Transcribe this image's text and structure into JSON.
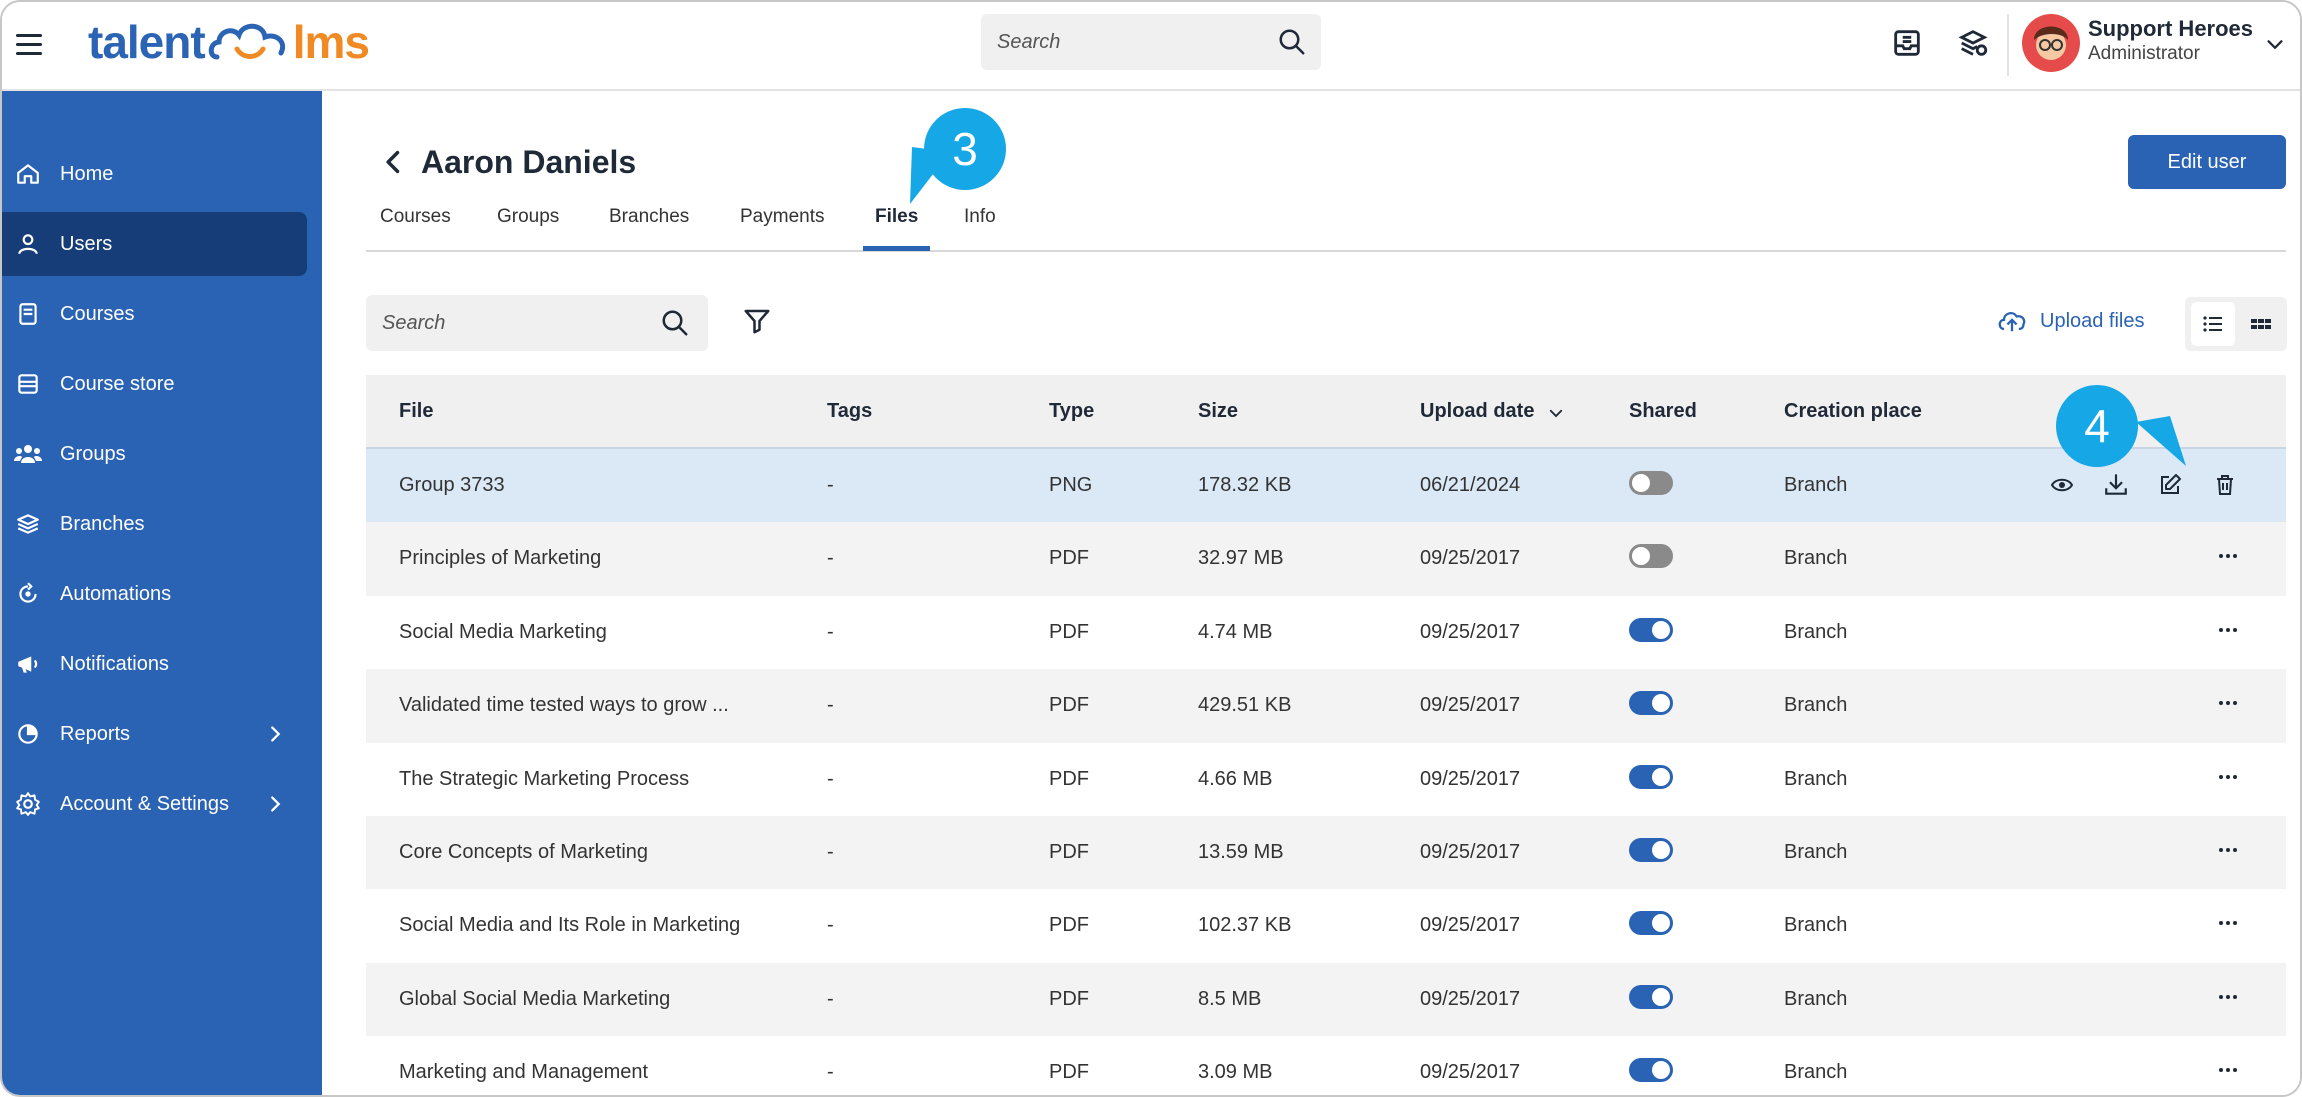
{
  "header": {
    "logo_part1": "talent",
    "logo_part2": "lms",
    "search_placeholder": "Search",
    "user_name": "Support Heroes",
    "user_role": "Administrator"
  },
  "sidebar": {
    "items": [
      {
        "label": "Home",
        "icon": "home-icon"
      },
      {
        "label": "Users",
        "icon": "user-icon"
      },
      {
        "label": "Courses",
        "icon": "book-icon"
      },
      {
        "label": "Course store",
        "icon": "store-icon"
      },
      {
        "label": "Groups",
        "icon": "groups-icon"
      },
      {
        "label": "Branches",
        "icon": "layers-icon"
      },
      {
        "label": "Automations",
        "icon": "automation-icon"
      },
      {
        "label": "Notifications",
        "icon": "megaphone-icon"
      },
      {
        "label": "Reports",
        "icon": "pie-chart-icon"
      },
      {
        "label": "Account & Settings",
        "icon": "gear-icon"
      }
    ]
  },
  "page": {
    "title": "Aaron Daniels",
    "edit_button": "Edit user"
  },
  "tabs": [
    {
      "label": "Courses"
    },
    {
      "label": "Groups"
    },
    {
      "label": "Branches"
    },
    {
      "label": "Payments"
    },
    {
      "label": "Files"
    },
    {
      "label": "Info"
    }
  ],
  "callouts": {
    "tab_badge": "3",
    "actions_badge": "4"
  },
  "toolbar": {
    "search_placeholder": "Search",
    "upload_label": "Upload files"
  },
  "table": {
    "columns": [
      "File",
      "Tags",
      "Type",
      "Size",
      "Upload date",
      "Shared",
      "Creation place"
    ],
    "rows": [
      {
        "file": "Group 3733",
        "tags": "-",
        "type": "PNG",
        "size": "178.32 KB",
        "date": "06/21/2024",
        "shared": false,
        "place": "Branch"
      },
      {
        "file": "Principles of Marketing",
        "tags": "-",
        "type": "PDF",
        "size": "32.97 MB",
        "date": "09/25/2017",
        "shared": false,
        "place": "Branch"
      },
      {
        "file": "Social Media Marketing",
        "tags": "-",
        "type": "PDF",
        "size": "4.74 MB",
        "date": "09/25/2017",
        "shared": true,
        "place": "Branch"
      },
      {
        "file": "Validated time tested ways to grow ...",
        "tags": "-",
        "type": "PDF",
        "size": "429.51 KB",
        "date": "09/25/2017",
        "shared": true,
        "place": "Branch"
      },
      {
        "file": "The Strategic Marketing Process",
        "tags": "-",
        "type": "PDF",
        "size": "4.66 MB",
        "date": "09/25/2017",
        "shared": true,
        "place": "Branch"
      },
      {
        "file": "Core Concepts of Marketing",
        "tags": "-",
        "type": "PDF",
        "size": "13.59 MB",
        "date": "09/25/2017",
        "shared": true,
        "place": "Branch"
      },
      {
        "file": "Social Media and Its Role in Marketing",
        "tags": "-",
        "type": "PDF",
        "size": "102.37 KB",
        "date": "09/25/2017",
        "shared": true,
        "place": "Branch"
      },
      {
        "file": "Global Social Media Marketing",
        "tags": "-",
        "type": "PDF",
        "size": "8.5 MB",
        "date": "09/25/2017",
        "shared": true,
        "place": "Branch"
      },
      {
        "file": "Marketing and Management",
        "tags": "-",
        "type": "PDF",
        "size": "3.09 MB",
        "date": "09/25/2017",
        "shared": true,
        "place": "Branch"
      }
    ]
  },
  "colors": {
    "brand_blue": "#2a62b4",
    "sidebar_active": "#173d78",
    "callout": "#16a7e6",
    "logo_orange": "#f08a24"
  }
}
